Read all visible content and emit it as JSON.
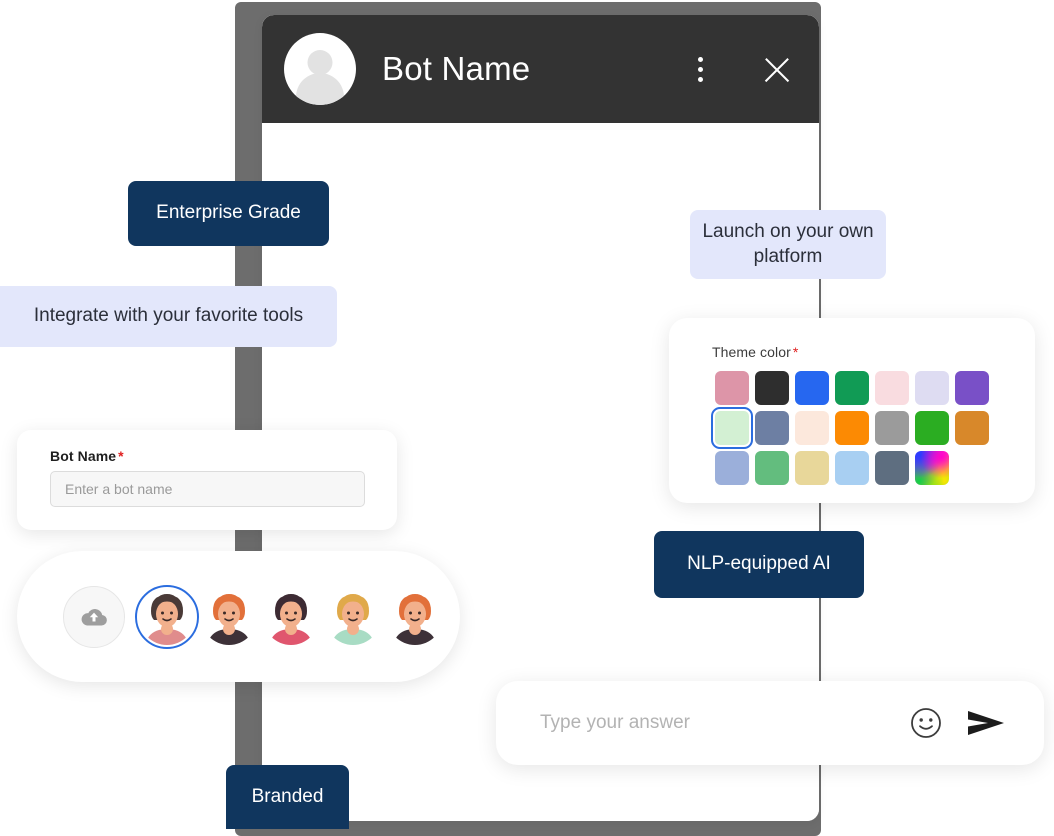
{
  "chat_window": {
    "header": {
      "title": "Bot Name",
      "avatar_icon": "person-avatar-icon",
      "menu_icon": "kebab-menu-icon",
      "close_icon": "close-icon"
    },
    "input_bar": {
      "placeholder": "Type your answer",
      "value": "",
      "emoji_icon": "smiley-face-icon",
      "send_icon": "send-paper-plane-icon"
    }
  },
  "badges": [
    {
      "id": "enterprise",
      "label": "Enterprise Grade",
      "style": "dark",
      "color": "#10365E"
    },
    {
      "id": "integrate",
      "label": "Integrate with your favorite tools",
      "style": "light",
      "color": "#E3E7FB"
    },
    {
      "id": "launch",
      "label": "Launch on your own platform",
      "style": "light",
      "color": "#E3E7FB"
    },
    {
      "id": "nlp",
      "label": "NLP-equipped AI",
      "style": "dark",
      "color": "#10365E"
    },
    {
      "id": "branded",
      "label": "Branded",
      "style": "dark",
      "color": "#10365E"
    }
  ],
  "bot_name_card": {
    "label": "Bot Name",
    "required_marker": "*",
    "placeholder": "Enter a bot name",
    "value": ""
  },
  "avatar_picker": {
    "upload_icon": "cloud-upload-icon",
    "selected_index": 0,
    "avatars": [
      {
        "name": "avatar-man-dark-hair",
        "skin": "#f2b08c",
        "hair": "#4a3a37",
        "shirt": "#e08c8c"
      },
      {
        "name": "avatar-woman-red-hair",
        "skin": "#f2b08c",
        "hair": "#e2703a",
        "shirt": "#3d3138"
      },
      {
        "name": "avatar-girl-black-bob",
        "skin": "#f2b08c",
        "hair": "#3d2b33",
        "shirt": "#e0566e"
      },
      {
        "name": "avatar-woman-blonde",
        "skin": "#f2b08c",
        "hair": "#e0a94a",
        "shirt": "#a8dcc4"
      },
      {
        "name": "avatar-man-beard-ginger",
        "skin": "#f2b08c",
        "hair": "#e2703a",
        "shirt": "#3d3138"
      }
    ]
  },
  "theme_color": {
    "label": "Theme color",
    "required_marker": "*",
    "selected_index": 7,
    "swatches": [
      {
        "name": "swatch-rose",
        "hex": "#DD95A8"
      },
      {
        "name": "swatch-near-black",
        "hex": "#2E2E2E"
      },
      {
        "name": "swatch-blue",
        "hex": "#2667F0"
      },
      {
        "name": "swatch-green",
        "hex": "#119B55"
      },
      {
        "name": "swatch-light-pink",
        "hex": "#F9DCE0"
      },
      {
        "name": "swatch-lavender",
        "hex": "#DEDCF2"
      },
      {
        "name": "swatch-purple",
        "hex": "#7950C7"
      },
      {
        "name": "swatch-mint",
        "hex": "#D3F0D3"
      },
      {
        "name": "swatch-slate-blue",
        "hex": "#6D7FA3"
      },
      {
        "name": "swatch-cream",
        "hex": "#FCE8DC"
      },
      {
        "name": "swatch-orange",
        "hex": "#FC8A03"
      },
      {
        "name": "swatch-gray",
        "hex": "#9B9B9B"
      },
      {
        "name": "swatch-grass-green",
        "hex": "#2BAD22"
      },
      {
        "name": "swatch-amber",
        "hex": "#D8882A"
      },
      {
        "name": "swatch-periwinkle",
        "hex": "#9BAFDA"
      },
      {
        "name": "swatch-jade",
        "hex": "#63BD7E"
      },
      {
        "name": "swatch-sand",
        "hex": "#E8D79A"
      },
      {
        "name": "swatch-sky",
        "hex": "#A8CFF2"
      },
      {
        "name": "swatch-steel",
        "hex": "#5E6E80"
      },
      {
        "name": "swatch-custom-rainbow",
        "hex": "rainbow"
      }
    ]
  }
}
